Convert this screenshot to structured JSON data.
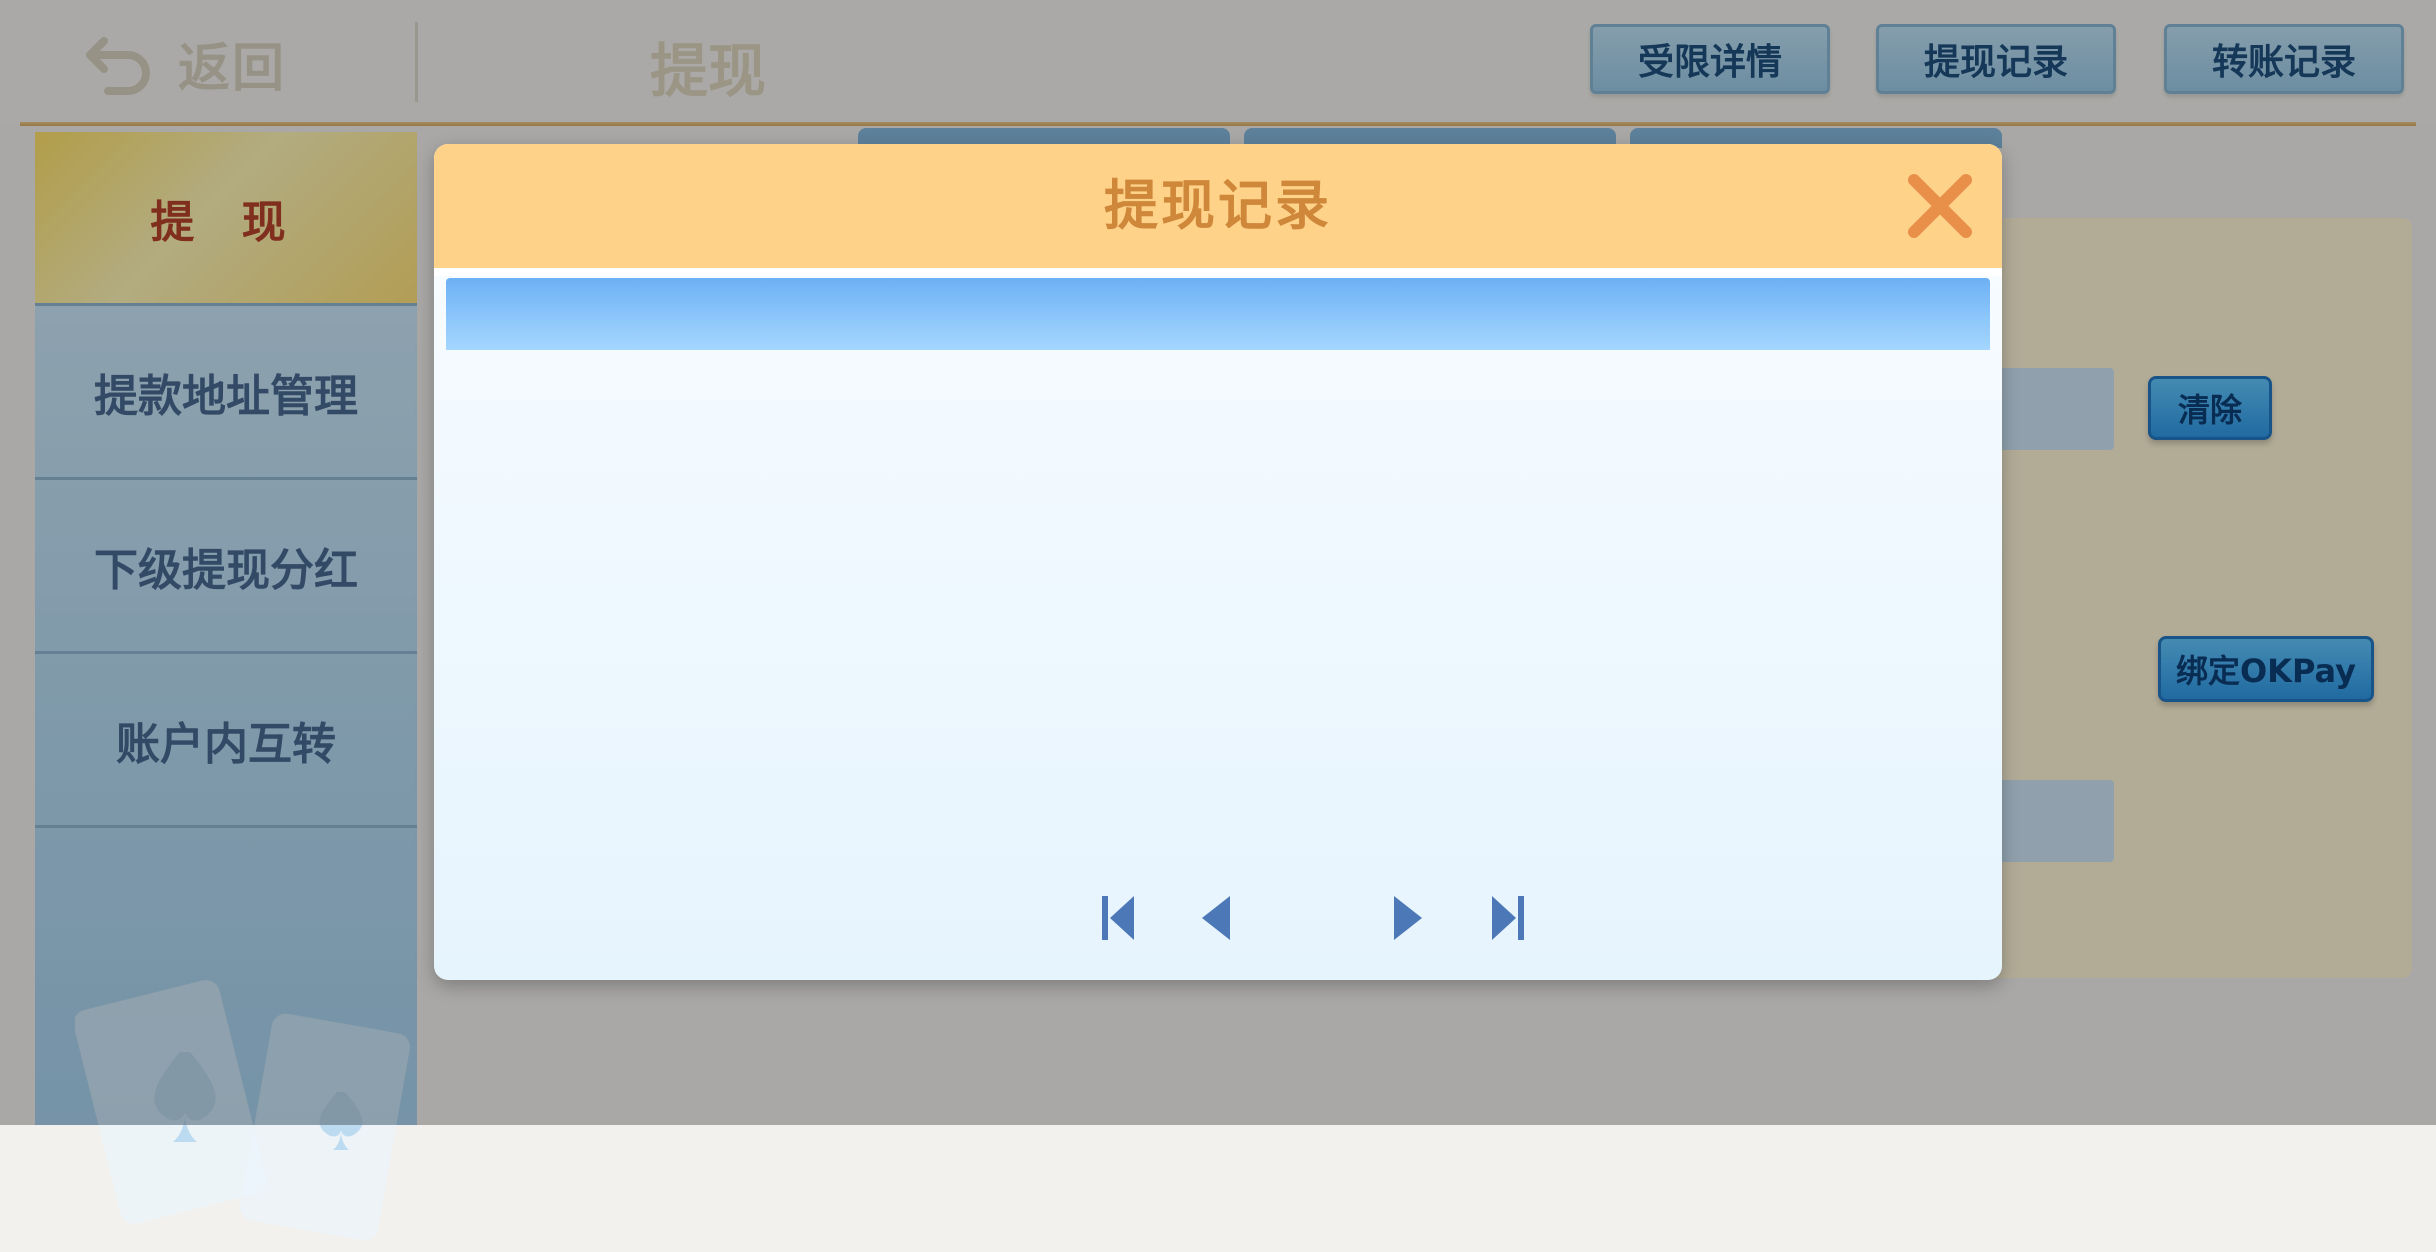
{
  "topbar": {
    "back_label": "返回",
    "title": "提现",
    "buttons": [
      "受限详情",
      "提现记录",
      "转账记录"
    ]
  },
  "sidebar": {
    "items": [
      {
        "label": "提 现",
        "active": true
      },
      {
        "label": "提款地址管理",
        "active": false
      },
      {
        "label": "下级提现分红",
        "active": false
      },
      {
        "label": "账户内互转",
        "active": false
      }
    ]
  },
  "panel": {
    "clear_button": "清除",
    "bind_button": "绑定OKPay"
  },
  "modal": {
    "title": "提现记录",
    "close_icon": "close-icon",
    "pager_icons": [
      "first-page-icon",
      "prev-page-icon",
      "next-page-icon",
      "last-page-icon"
    ]
  },
  "colors": {
    "modal_header": "#ffd28a",
    "modal_title": "#cf873a",
    "table_header": "#8fc8fb",
    "pager_icon": "#4d78b8",
    "overlay": "rgba(0,0,0,0.30)"
  }
}
